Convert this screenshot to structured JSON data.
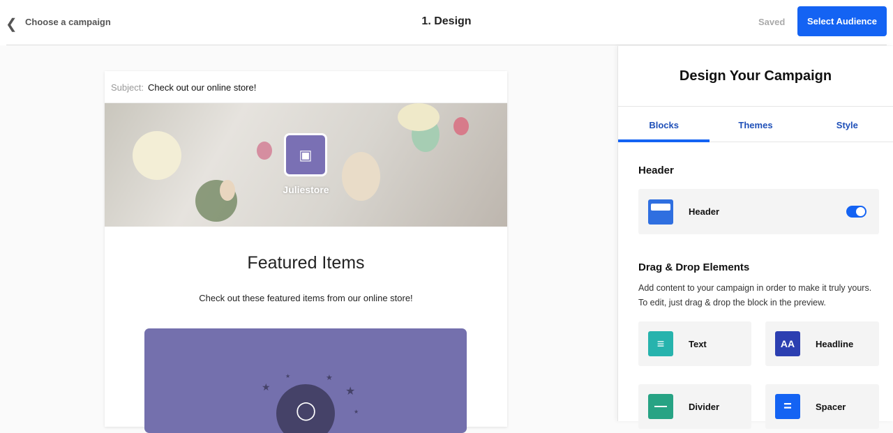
{
  "topbar": {
    "back_label": "Choose a campaign",
    "title": "1. Design",
    "status": "Saved",
    "primary_button": "Select Audience"
  },
  "email": {
    "subject_label": "Subject:",
    "subject_value": "Check out our online store!",
    "store_name": "Juliestore",
    "featured_title": "Featured Items",
    "featured_desc": "Check out these featured items from our online store!"
  },
  "panel": {
    "title": "Design Your Campaign",
    "tabs": [
      {
        "label": "Blocks"
      },
      {
        "label": "Themes"
      },
      {
        "label": "Style"
      }
    ],
    "header_section": "Header",
    "header_block": {
      "label": "Header",
      "enabled": true
    },
    "dnd_section": "Drag & Drop Elements",
    "dnd_desc": "Add content to your campaign in order to make it truly yours. To edit, just drag & drop the block in the preview.",
    "elements": [
      {
        "label": "Text",
        "color": "#27b3ad"
      },
      {
        "label": "Headline",
        "icon_text": "AA",
        "color": "#2c3fb1"
      },
      {
        "label": "Divider",
        "color": "#27a384"
      },
      {
        "label": "Spacer",
        "color": "#1463f3"
      }
    ]
  }
}
